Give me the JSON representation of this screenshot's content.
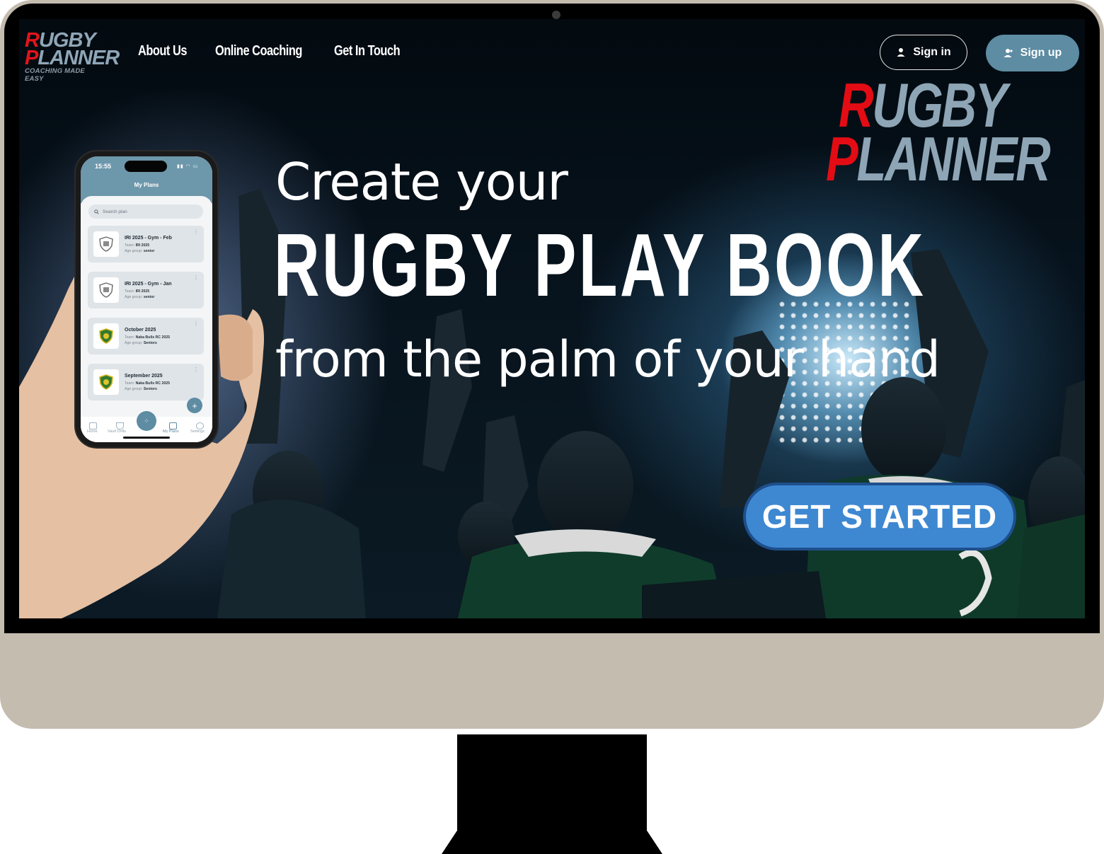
{
  "nav": {
    "logo": {
      "line1_cap": "R",
      "line1_rest": "UGBY",
      "line2_cap": "P",
      "line2_rest": "LANNER",
      "tagline": "COACHING MADE EASY"
    },
    "links": [
      "About Us",
      "Online Coaching",
      "Get In Touch"
    ],
    "sign_in": "Sign in",
    "sign_up": "Sign up"
  },
  "big_logo": {
    "line1_cap": "R",
    "line1_rest": "UGBY",
    "line2_cap": "P",
    "line2_rest": "LANNER"
  },
  "hero": {
    "line1": "Create your",
    "line2": "RUGBY PLAY BOOK",
    "line3": "from the palm of your hand",
    "cta": "GET STARTED"
  },
  "phone": {
    "time": "15:55",
    "title": "My Plans",
    "search_placeholder": "Search plan",
    "plans": [
      {
        "title": "IRI 2025 - Gym - Feb",
        "team_label": "Team:",
        "team": "IRI 2025",
        "age_label": "Age group:",
        "age": "senior",
        "badge": "shield-grey"
      },
      {
        "title": "IRI 2025 - Gym - Jan",
        "team_label": "Team:",
        "team": "IRI 2025",
        "age_label": "Age group:",
        "age": "senior",
        "badge": "shield-grey"
      },
      {
        "title": "October 2025",
        "team_label": "Team:",
        "team": "Naka Bulls RC 2025",
        "age_label": "Age group:",
        "age": "Seniors",
        "badge": "shield-green"
      },
      {
        "title": "September 2025",
        "team_label": "Team:",
        "team": "Naka Bulls RC 2025",
        "age_label": "Age group:",
        "age": "Seniors",
        "badge": "shield-green"
      }
    ],
    "tabs": [
      "Home",
      "Vault Drills",
      "My Plans",
      "Settings"
    ]
  },
  "colors": {
    "logo_red": "#e40c14",
    "logo_blue_grey": "#8ea5b6",
    "sign_up_bg": "#5d8ca3",
    "cta_bg": "#3e88d2",
    "monitor_body": "#c4bcaf"
  }
}
